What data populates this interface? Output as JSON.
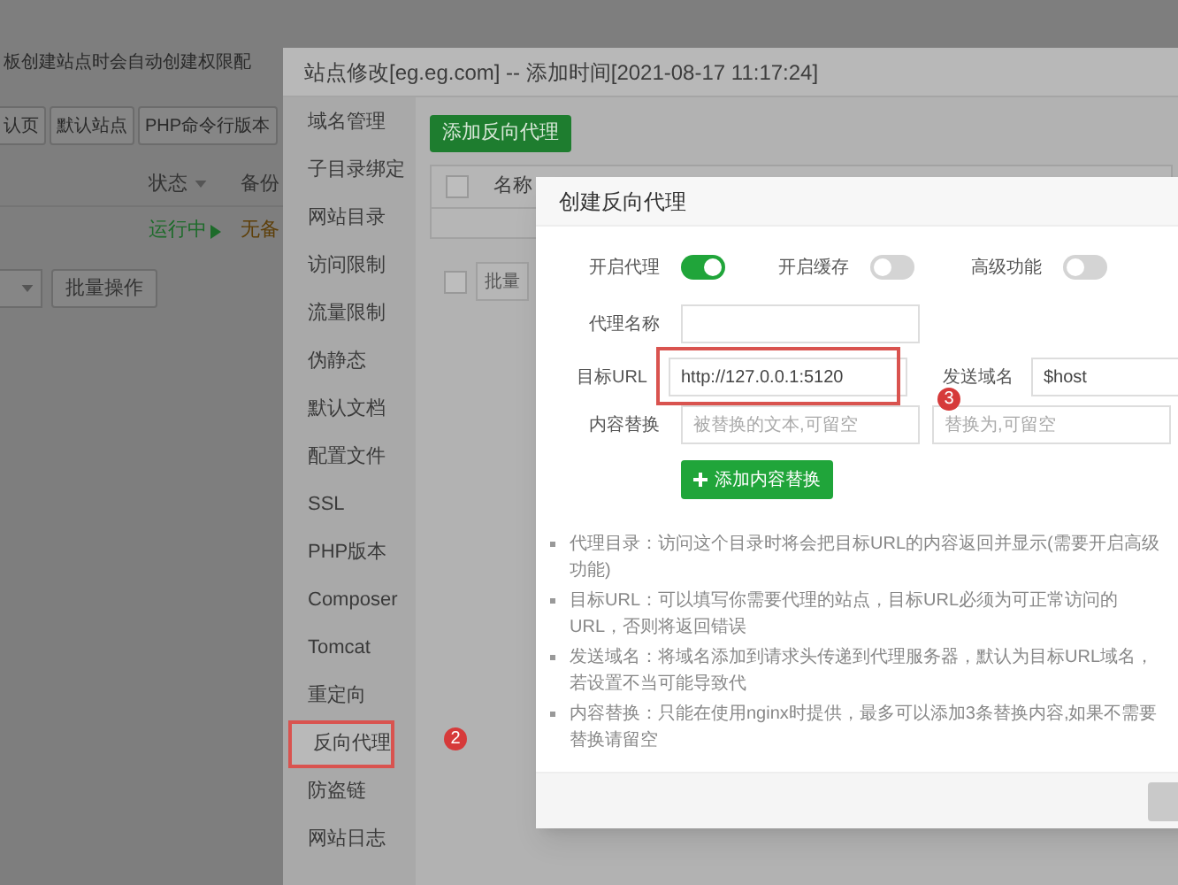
{
  "background_page": {
    "notice": "板创建站点时会自动创建权限配",
    "buttons": [
      "认页",
      "默认站点",
      "PHP命令行版本"
    ],
    "table": {
      "columns": [
        "状态",
        "备份"
      ],
      "rows": [
        {
          "status": "运行中",
          "backup": "无备"
        }
      ]
    },
    "batch_button": "批量操作"
  },
  "site_window": {
    "title": "站点修改[eg.eg.com] -- 添加时间[2021-08-17 11:17:24]",
    "sidebar": {
      "items": [
        {
          "label": "域名管理",
          "selected": false,
          "highlighted": false
        },
        {
          "label": "子目录绑定",
          "selected": false,
          "highlighted": false
        },
        {
          "label": "网站目录",
          "selected": false,
          "highlighted": false
        },
        {
          "label": "访问限制",
          "selected": false,
          "highlighted": false
        },
        {
          "label": "流量限制",
          "selected": false,
          "highlighted": false
        },
        {
          "label": "伪静态",
          "selected": false,
          "highlighted": false
        },
        {
          "label": "默认文档",
          "selected": false,
          "highlighted": false
        },
        {
          "label": "配置文件",
          "selected": false,
          "highlighted": false
        },
        {
          "label": "SSL",
          "selected": false,
          "highlighted": false
        },
        {
          "label": "PHP版本",
          "selected": false,
          "highlighted": false
        },
        {
          "label": "Composer",
          "selected": false,
          "highlighted": false
        },
        {
          "label": "Tomcat",
          "selected": false,
          "highlighted": false
        },
        {
          "label": "重定向",
          "selected": false,
          "highlighted": false
        },
        {
          "label": "反向代理",
          "selected": true,
          "highlighted": true
        },
        {
          "label": "防盗链",
          "selected": false,
          "highlighted": false
        },
        {
          "label": "网站日志",
          "selected": false,
          "highlighted": false
        }
      ]
    },
    "add_button": "添加反向代理",
    "table": {
      "columns": [
        "名称"
      ],
      "header_checkbox": {
        "checked": false
      }
    },
    "batch_checkbox": {
      "checked": false
    },
    "batch_button": "批量",
    "step_badge": "2"
  },
  "dialog": {
    "title": "创建反向代理",
    "toggles": [
      {
        "label": "开启代理",
        "on": true
      },
      {
        "label": "开启缓存",
        "on": false
      },
      {
        "label": "高级功能",
        "on": false
      }
    ],
    "proxy_name": {
      "label": "代理名称"
    },
    "target_url": {
      "label": "目标URL",
      "value": "http://127.0.0.1:5120",
      "highlighted": true
    },
    "send_domain": {
      "label": "发送域名",
      "value": "$host"
    },
    "content_replace": {
      "label": "内容替换",
      "from_placeholder": "被替换的文本,可留空",
      "to_placeholder": "替换为,可留空"
    },
    "add_replace_button": "添加内容替换",
    "step_badge": "3",
    "notes": [
      "代理目录：访问这个目录时将会把目标URL的内容返回并显示(需要开启高级功能)",
      "目标URL：可以填写你需要代理的站点，目标URL必须为可正常访问的URL，否则将返回错误",
      "发送域名：将域名添加到请求头传递到代理服务器，默认为目标URL域名，若设置不当可能导致代",
      "内容替换：只能在使用nginx时提供，最多可以添加3条替换内容,如果不需要替换请留空"
    ]
  }
}
